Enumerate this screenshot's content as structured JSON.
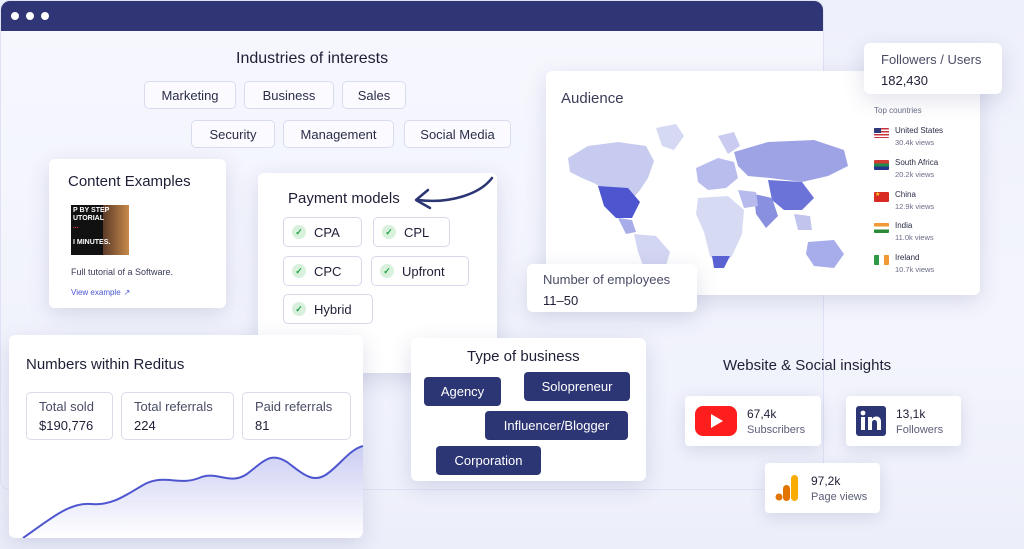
{
  "industries": {
    "title": "Industries of interests",
    "tags": [
      "Marketing",
      "Business",
      "Sales",
      "Security",
      "Management",
      "Social Media"
    ]
  },
  "content_examples": {
    "title": "Content Examples",
    "thumbnail_text": [
      "P BY STEP",
      "UTORIAL",
      "...",
      "I MINUTES."
    ],
    "caption": "Full tutorial of a Software.",
    "link": "View example"
  },
  "payment_models": {
    "title": "Payment models",
    "items": [
      "CPA",
      "CPL",
      "CPC",
      "Upfront",
      "Hybrid"
    ]
  },
  "audience": {
    "title": "Audience",
    "top_countries_label": "Top countries",
    "countries": [
      {
        "name": "United States",
        "views": "30.4k views"
      },
      {
        "name": "South Africa",
        "views": "20.2k views"
      },
      {
        "name": "China",
        "views": "12.9k views"
      },
      {
        "name": "India",
        "views": "11.0k views"
      },
      {
        "name": "Ireland",
        "views": "10.7k views"
      }
    ]
  },
  "followers": {
    "label": "Followers / Users",
    "value": "182,430"
  },
  "employees": {
    "label": "Number of employees",
    "value": "11–50"
  },
  "numbers": {
    "title": "Numbers within Reditus",
    "stats": [
      {
        "label": "Total sold",
        "value": "$190,776"
      },
      {
        "label": "Total referrals",
        "value": "224"
      },
      {
        "label": "Paid referrals",
        "value": "81"
      }
    ]
  },
  "business_type": {
    "title": "Type of business",
    "items": [
      "Agency",
      "Solopreneur",
      "Influencer/Blogger",
      "Corporation"
    ]
  },
  "insights": {
    "title": "Website & Social insights",
    "youtube": {
      "value": "67,4k",
      "label": "Subscribers"
    },
    "linkedin": {
      "value": "13,1k",
      "label": "Followers"
    },
    "analytics": {
      "value": "97,2k",
      "label": "Page views"
    }
  },
  "colors": {
    "navy": "#2d3674",
    "accent": "#5a5fd6",
    "check_green": "#23a046"
  }
}
